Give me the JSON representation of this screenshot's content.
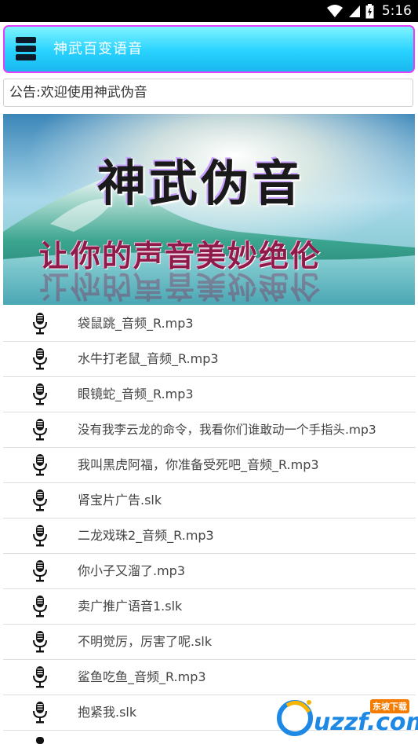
{
  "status_bar": {
    "time": "5:16",
    "icons": [
      "wifi-icon",
      "signal-icon",
      "battery-icon"
    ]
  },
  "header": {
    "menu_icon": "menu-icon",
    "title": "神武百变语音"
  },
  "notice": {
    "text": "公告:欢迎使用神武伪音"
  },
  "banner": {
    "title": "神武伪音",
    "slogan": "让你的声音美妙绝伦"
  },
  "audio_list": {
    "items": [
      "袋鼠跳_音频_R.mp3",
      "水牛打老鼠_音频_R.mp3",
      "眼镜蛇_音频_R.mp3",
      "没有我李云龙的命令，我看你们谁敢动一个手指头.mp3",
      "我叫黑虎阿福，你准备受死吧_音频_R.mp3",
      "肾宝片广告.slk",
      "二龙戏珠2_音频_R.mp3",
      "你小子又溜了.mp3",
      "卖广推广语音1.slk",
      "不明觉厉，厉害了呢.slk",
      "鲨鱼吃鱼_音频_R.mp3",
      "抱紧我.slk"
    ],
    "item_icon": "microphone-icon"
  },
  "watermark": {
    "brand": "uzzf.com",
    "tag": "东坡下载"
  },
  "colors": {
    "header_border": "#e040fb",
    "header_bg": "#28d2ff",
    "status_bar": "#000000"
  }
}
